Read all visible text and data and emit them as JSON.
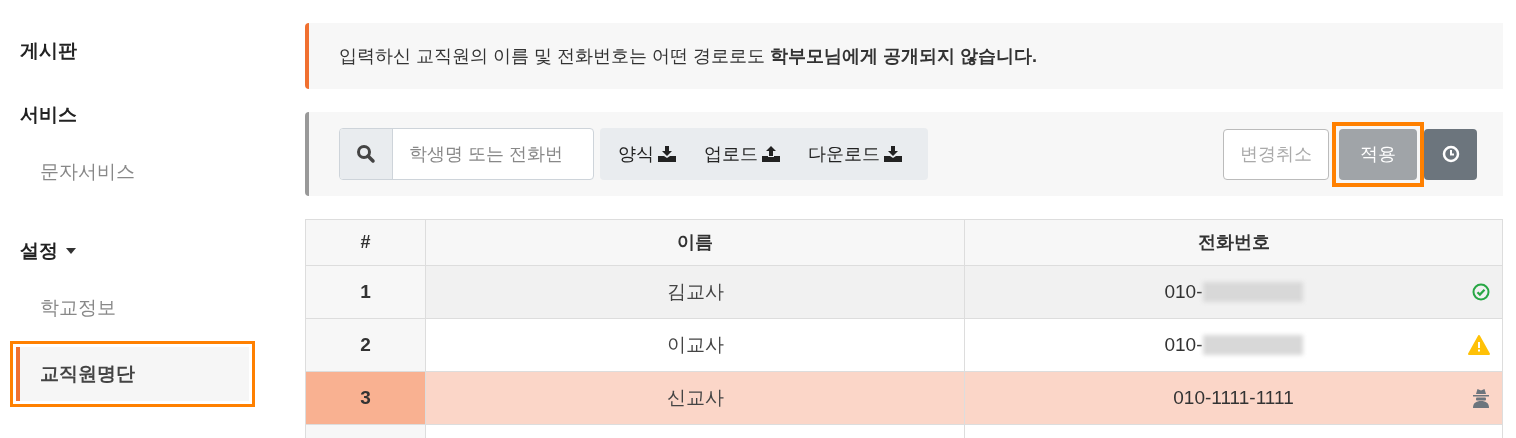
{
  "sidebar": {
    "sections": [
      {
        "title": "게시판",
        "has_caret": false
      },
      {
        "title": "서비스",
        "has_caret": false,
        "items": [
          {
            "label": "문자서비스",
            "selected": false,
            "annotated": false
          }
        ]
      },
      {
        "title": "설정",
        "has_caret": true,
        "items": [
          {
            "label": "학교정보",
            "selected": false,
            "annotated": false
          },
          {
            "label": "교직원명단",
            "selected": true,
            "annotated": true
          }
        ]
      }
    ]
  },
  "notice": {
    "text": "입력하신 교직원의 이름 및 전화번호는 어떤 경로로도 **학부모님에게 공개되지 않습니다.**"
  },
  "toolbar": {
    "search": {
      "placeholder": "학생명 또는 전화번"
    },
    "file_buttons": [
      {
        "label": "양식",
        "kind": "download"
      },
      {
        "label": "업로드",
        "kind": "upload"
      },
      {
        "label": "다운로드",
        "kind": "download"
      }
    ],
    "cancel_button": {
      "label": "변경취소"
    },
    "apply_button": {
      "label": "적용",
      "disabled": true,
      "annotated": true
    }
  },
  "table": {
    "columns": [
      "#",
      "이름",
      "전화번호"
    ],
    "rows": [
      {
        "index": "1",
        "name": "김교사",
        "phone": "010-",
        "redacted": true,
        "kind": "ok",
        "hovered": true,
        "selected": false
      },
      {
        "index": "2",
        "name": "이교사",
        "phone": "010-",
        "redacted": true,
        "kind": "warning",
        "hovered": false,
        "selected": false
      },
      {
        "index": "3",
        "name": "신교사",
        "phone": "010-1111-1111",
        "redacted": false,
        "kind": "hidden",
        "hovered": false,
        "selected": true
      }
    ]
  }
}
